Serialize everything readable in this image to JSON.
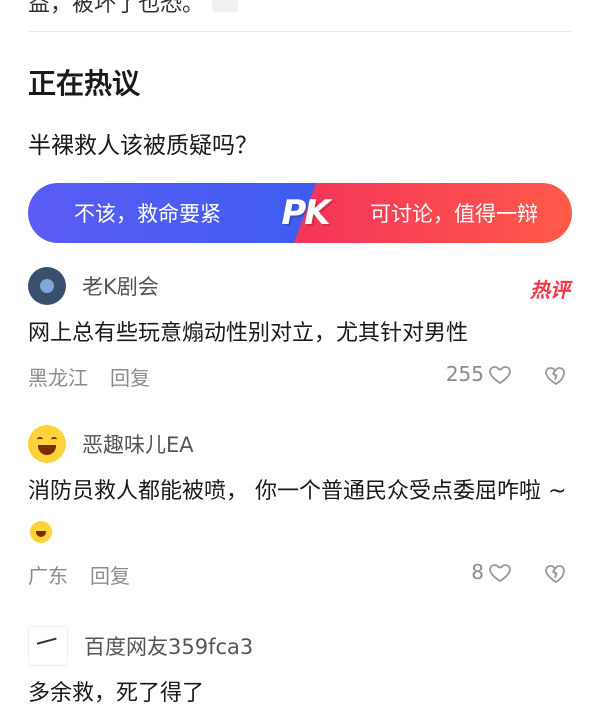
{
  "top_fragment": "益，被坏了也恐。",
  "section": {
    "title": "正在热议"
  },
  "topic": {
    "question": "半裸救人该被质疑吗？"
  },
  "pk": {
    "left_label": "不该，救命要紧",
    "badge": "PK",
    "right_label": "可讨论，值得一辩",
    "left_color": "#4b5cf3",
    "right_color": "#f6405a"
  },
  "comments": [
    {
      "nickname": "老K剧会",
      "tag": "热评",
      "text": "网上总有些玩意煽动性别对立，尤其针对男性",
      "location": "黑龙江",
      "reply_label": "回复",
      "likes": "255"
    },
    {
      "nickname": "恶趣味儿EA",
      "text": "消防员救人都能被喷， 你一个普通民众受点委屈咋啦 ~",
      "location": "广东",
      "reply_label": "回复",
      "likes": "8"
    },
    {
      "nickname": "百度网友359fca3",
      "text": "多余救，死了得了"
    }
  ],
  "icons": {
    "like": "heart-outline-icon",
    "dislike": "broken-heart-icon"
  }
}
